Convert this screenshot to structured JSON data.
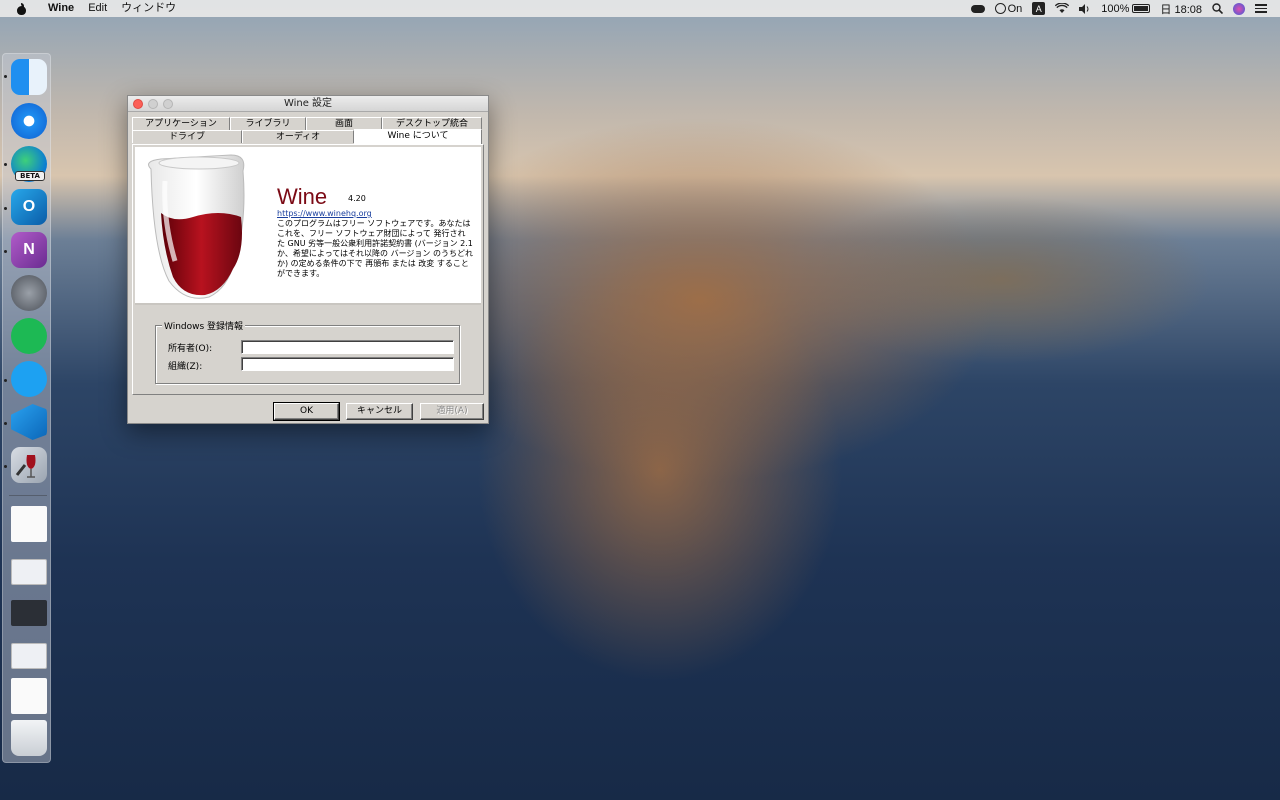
{
  "menubar": {
    "app_name": "Wine",
    "items": [
      "Edit",
      "ウィンドウ"
    ],
    "status_on": "On",
    "input_source": "A",
    "battery": "100%",
    "clock": "日 18:08"
  },
  "window": {
    "title": "Wine 設定",
    "tabs_top": [
      "アプリケーション",
      "ライブラリ",
      "画面",
      "デスクトップ統合"
    ],
    "tabs_bottom": [
      "ドライブ",
      "オーディオ",
      "Wine について"
    ],
    "active_tab": "Wine について",
    "about": {
      "name": "Wine",
      "version": "4.20",
      "link": "https://www.winehq.org",
      "license": "このプログラムはフリー ソフトウェアです。あなたはこれを、フリー ソフトウェア財団によって 発行された GNU 劣等一般公衆利用許諾契約書 (バージョン 2.1か、希望によってはそれ以降の バージョン のうちどれか) の定める条件の下で 再頒布 または 改変 することができます。"
    },
    "registration": {
      "group_title": "Windows 登録情報",
      "owner_label": "所有者(O):",
      "owner_value": "",
      "org_label": "組織(Z):",
      "org_value": ""
    },
    "buttons": {
      "ok": "OK",
      "cancel": "キャンセル",
      "apply": "適用(A)"
    }
  },
  "dock": {
    "items": [
      "finder-icon",
      "safari-icon",
      "edge-beta-icon",
      "outlook-icon",
      "onenote-icon",
      "launchpad-icon",
      "spotify-icon",
      "twitter-icon",
      "vscode-icon",
      "wine-config-icon"
    ],
    "edge_badge": "BETA",
    "recent": [
      "pdf-document",
      "edge-thumbnail",
      "vscode-thumbnail",
      "onenote-thumbnail",
      "twitter-thumbnail"
    ],
    "trash": "trash-icon"
  },
  "colors": {
    "wine_red": "#7b0a15",
    "link_blue": "#1a3f9e",
    "close_button": "#fc5f57"
  }
}
